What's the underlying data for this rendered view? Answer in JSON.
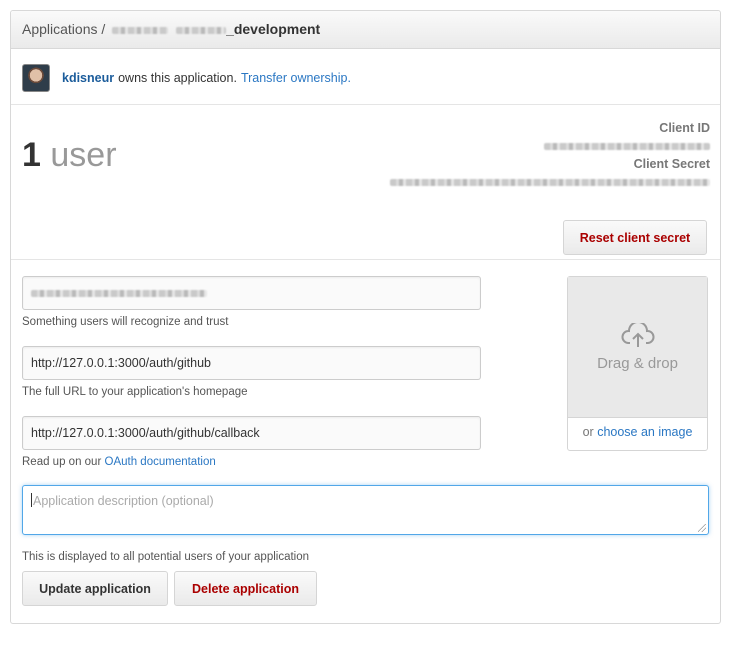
{
  "header": {
    "breadcrumb_root": "Applications",
    "separator": "/",
    "app_name_suffix": "_development"
  },
  "owner": {
    "username": "kdisneur",
    "text": "owns this application.",
    "transfer_link": "Transfer ownership."
  },
  "stats": {
    "user_count": "1",
    "user_label": "user",
    "client_id_label": "Client ID",
    "client_secret_label": "Client Secret",
    "reset_button": "Reset client secret"
  },
  "form": {
    "app_name_hint": "Something users will recognize and trust",
    "homepage_url": "http://127.0.0.1:3000/auth/github",
    "homepage_hint": "The full URL to your application's homepage",
    "callback_url": "http://127.0.0.1:3000/auth/github/callback",
    "callback_hint_prefix": "Read up on our",
    "callback_hint_link": "OAuth documentation",
    "description_placeholder": "Application description (optional)",
    "description_hint": "This is displayed to all potential users of your application",
    "update_button": "Update application",
    "delete_button": "Delete application"
  },
  "dropzone": {
    "label": "Drag & drop",
    "or_text": "or",
    "choose_link": "choose an image",
    "icon": "cloud-upload-icon"
  },
  "colors": {
    "link": "#2a77c3",
    "danger": "#aa0000",
    "focus": "#51a7e8"
  }
}
